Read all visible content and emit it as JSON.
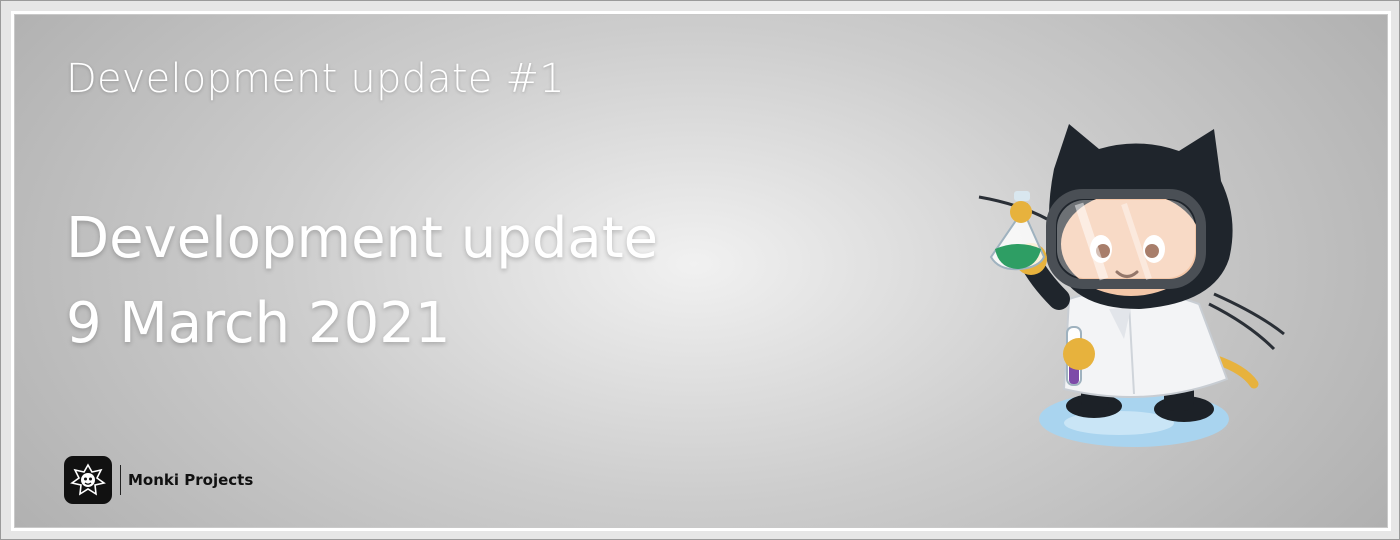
{
  "header": {
    "small_title": "Development update #1",
    "headline_line1": "Development update",
    "headline_line2": "9 March 2021"
  },
  "brand": {
    "name": "Monki Projects",
    "logo_icon": "monkey-face-icon"
  },
  "illustration": {
    "icon": "scientist-octocat-icon"
  },
  "colors": {
    "text": "#ffffff",
    "background_center": "#f1f1f1",
    "background_edge": "#ababab",
    "brand_text": "#111111"
  }
}
